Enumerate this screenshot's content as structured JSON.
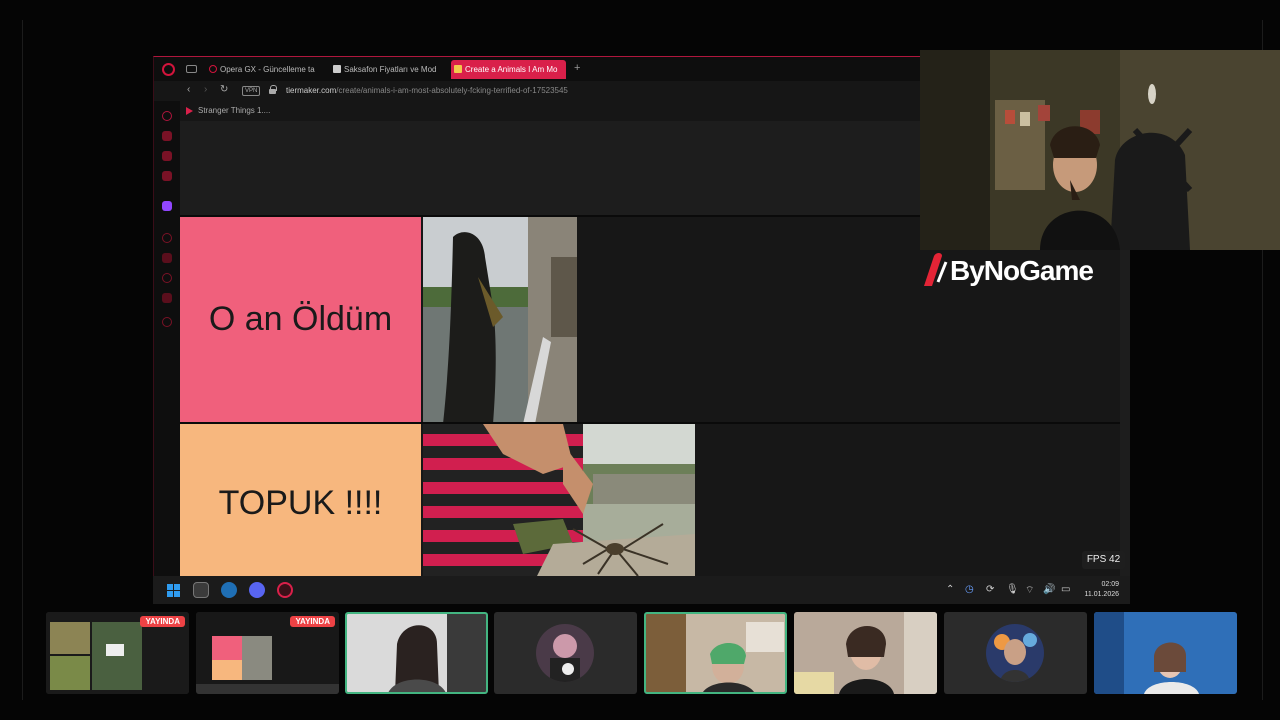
{
  "browser": {
    "tabs": [
      {
        "label": "Opera GX - Güncelleme ta",
        "active": false
      },
      {
        "label": "Saksafon Fiyatları ve Mod",
        "active": false
      },
      {
        "label": "Create a Animals I Am Mo",
        "active": true
      }
    ],
    "url_domain": "tiermaker.com",
    "url_path": "/create/animals-i-am-most-absolutely-fcking-terrified-of-17523545",
    "vpn_label": "VPN",
    "bookmark": "Stranger Things 1...."
  },
  "tierlist": {
    "rows": [
      {
        "label": "O an Öldüm",
        "color": "#f0607c"
      },
      {
        "label": "TOPUK !!!!",
        "color": "#f7b77e"
      }
    ]
  },
  "overlay": {
    "fps": "FPS 42",
    "logo": "ByNoGame"
  },
  "taskbar": {
    "time": "02:09",
    "date": "11.01.2026"
  },
  "participants": [
    {
      "type": "stream",
      "badge": "YAYINDA"
    },
    {
      "type": "stream",
      "badge": "YAYINDA"
    },
    {
      "type": "camera",
      "speaking": true
    },
    {
      "type": "avatar"
    },
    {
      "type": "camera",
      "speaking": true
    },
    {
      "type": "camera"
    },
    {
      "type": "avatar"
    },
    {
      "type": "camera"
    }
  ],
  "colors": {
    "accent": "#d9204a",
    "speaking": "#43b581",
    "live": "#ed4245"
  }
}
